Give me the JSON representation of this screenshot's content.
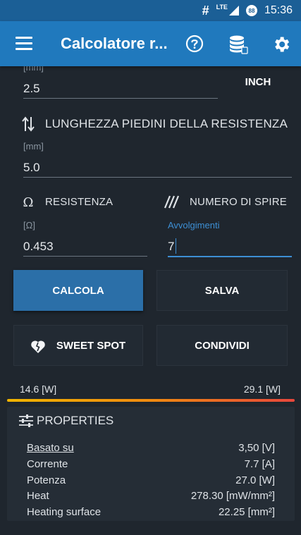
{
  "status": {
    "time": "15:36",
    "network": "LTE",
    "battery": "88"
  },
  "appbar": {
    "title": "Calcolatore r..."
  },
  "fields": {
    "diameter": {
      "unit": "[mm]",
      "value": "2.5",
      "inch_label": "INCH"
    },
    "lead_length": {
      "label": "LUNGHEZZA PIEDINI DELLA RESISTENZA",
      "unit": "[mm]",
      "value": "5.0"
    },
    "resistance": {
      "label": "RESISTENZA",
      "unit": "[Ω]",
      "value": "0.453"
    },
    "turns": {
      "label": "NUMERO DI SPIRE",
      "hint": "Avvolgimenti",
      "value": "7"
    }
  },
  "buttons": {
    "calcola": "CALCOLA",
    "salva": "SALVA",
    "sweet_spot": "SWEET SPOT",
    "condividi": "CONDIVIDI"
  },
  "range": {
    "min": "14.6 [W]",
    "max": "29.1 [W]"
  },
  "properties": {
    "title": "PROPERTIES",
    "rows": [
      {
        "label": "Basato su",
        "value": "3,50 [V]"
      },
      {
        "label": "Corrente",
        "value": "7.7 [A]"
      },
      {
        "label": "Potenza",
        "value": "27.0 [W]"
      },
      {
        "label": "Heat",
        "value": "278.30 [mW/mm²]"
      },
      {
        "label": "Heating surface",
        "value": "22.25 [mm²]"
      }
    ]
  }
}
